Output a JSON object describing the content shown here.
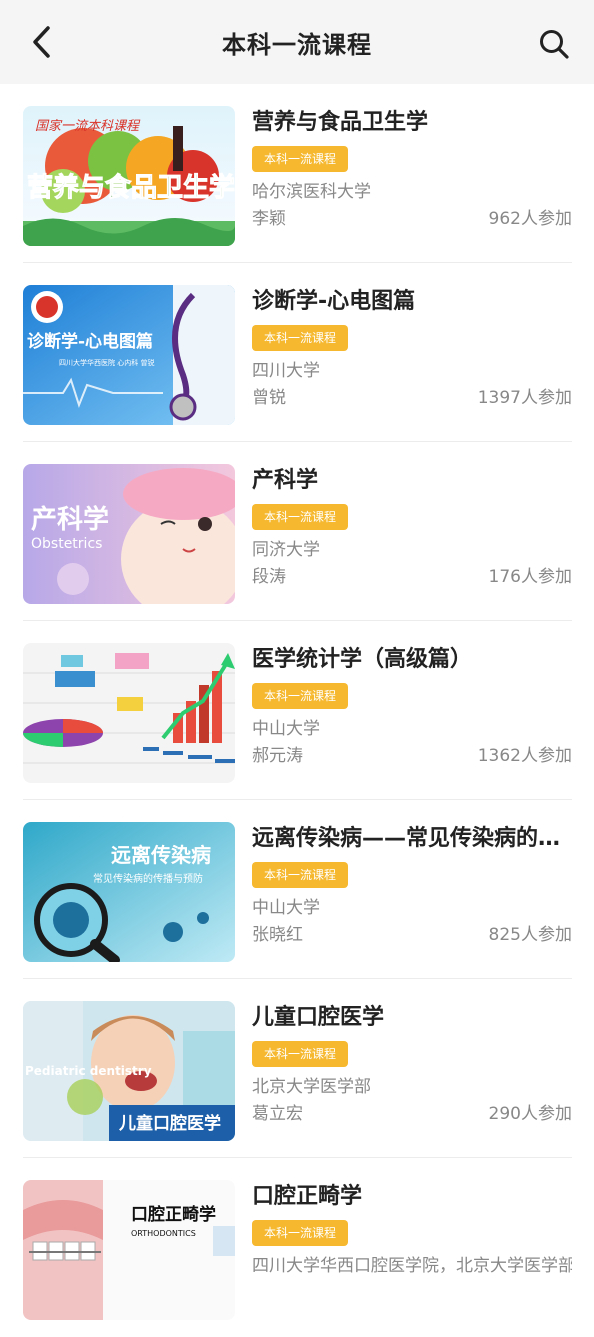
{
  "header": {
    "title": "本科一流课程"
  },
  "courses": [
    {
      "title": "营养与食品卫生学",
      "badge": "本科一流课程",
      "school": "哈尔滨医科大学",
      "teacher": "李颖",
      "participants": "962人参加",
      "thumb": {
        "banner": "国家一流本科课程",
        "text": "营养与食品卫生学"
      }
    },
    {
      "title": "诊断学-心电图篇",
      "badge": "本科一流课程",
      "school": "四川大学",
      "teacher": "曾锐",
      "participants": "1397人参加",
      "thumb": {
        "text": "诊断学-心电图篇",
        "sub": "四川大学华西医院  心内科  曾锐"
      }
    },
    {
      "title": "产科学",
      "badge": "本科一流课程",
      "school": "同济大学",
      "teacher": "段涛",
      "participants": "176人参加",
      "thumb": {
        "text": "产科学",
        "sub": "Obstetrics"
      }
    },
    {
      "title": "医学统计学（高级篇）",
      "badge": "本科一流课程",
      "school": "中山大学",
      "teacher": "郝元涛",
      "participants": "1362人参加",
      "thumb": {}
    },
    {
      "title": "远离传染病——常见传染病的传播与预防",
      "badge": "本科一流课程",
      "school": "中山大学",
      "teacher": "张晓红",
      "participants": "825人参加",
      "thumb": {
        "text": "远离传染病",
        "sub": "常见传染病的传播与预防"
      }
    },
    {
      "title": "儿童口腔医学",
      "badge": "本科一流课程",
      "school": "北京大学医学部",
      "teacher": "葛立宏",
      "participants": "290人参加",
      "thumb": {
        "text": "儿童口腔医学",
        "sub": "Pediatric dentistry"
      }
    },
    {
      "title": "口腔正畸学",
      "badge": "本科一流课程",
      "school": "四川大学华西口腔医学院，北京大学医学部",
      "teacher": "",
      "participants": "",
      "thumb": {
        "text": "口腔正畸学",
        "sub": "ORTHODONTICS"
      }
    }
  ]
}
